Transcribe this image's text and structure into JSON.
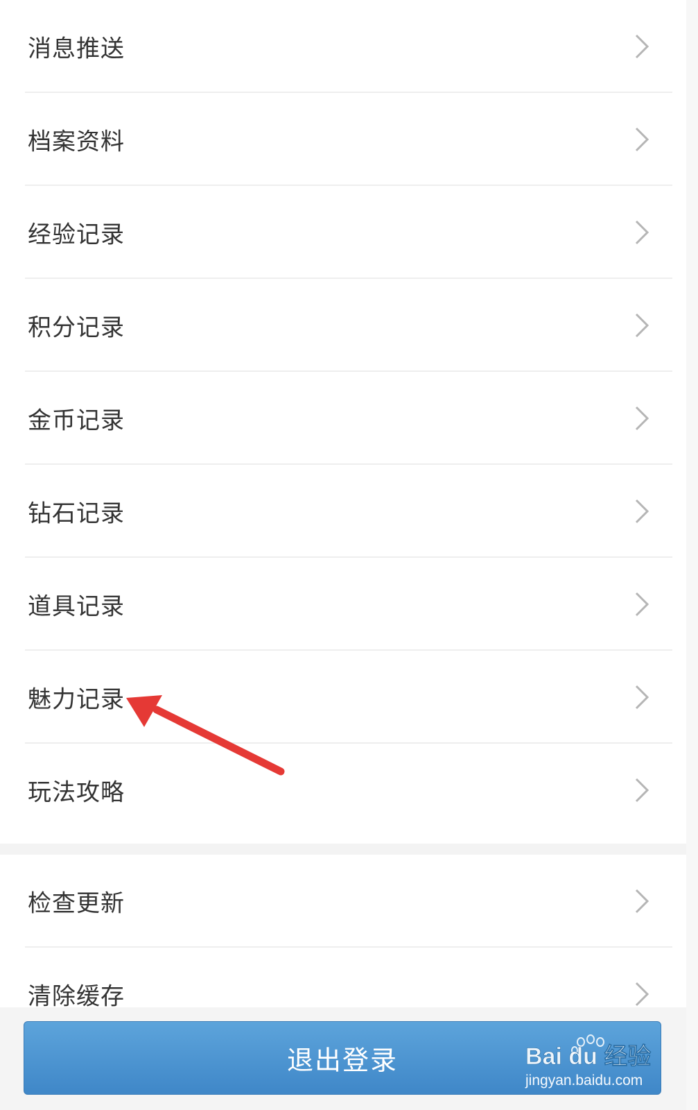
{
  "settings_group_1": {
    "items": [
      {
        "label": "消息推送"
      },
      {
        "label": "档案资料"
      },
      {
        "label": "经验记录"
      },
      {
        "label": "积分记录"
      },
      {
        "label": "金币记录"
      },
      {
        "label": "钻石记录"
      },
      {
        "label": "道具记录"
      },
      {
        "label": "魅力记录"
      },
      {
        "label": "玩法攻略"
      }
    ]
  },
  "settings_group_2": {
    "items": [
      {
        "label": "检查更新"
      },
      {
        "label": "清除缓存"
      }
    ]
  },
  "logout_button": {
    "label": "退出登录"
  },
  "watermark": {
    "brand": "Bai du 经验",
    "url": "jingyan.baidu.com"
  },
  "annotation": {
    "target": "魅力记录",
    "color": "#e53935"
  },
  "icons": {
    "row_chevron": "chevron-right-icon"
  }
}
